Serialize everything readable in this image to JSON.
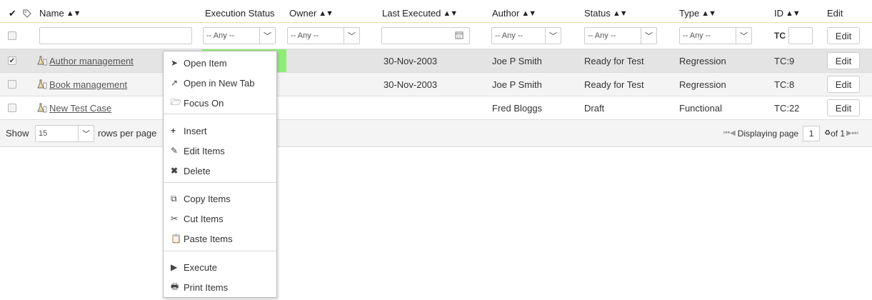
{
  "header": {
    "check_icon": "✔",
    "tag_icon": "🏷",
    "name": "Name",
    "execution_status": "Execution Status",
    "owner": "Owner",
    "last_executed": "Last Executed",
    "author": "Author",
    "status": "Status",
    "type": "Type",
    "id": "ID",
    "edit": "Edit",
    "sort_glyph": "▲▼"
  },
  "filters": {
    "any": "-- Any --",
    "id_prefix": "TC",
    "edit_label": "Edit"
  },
  "rows": [
    {
      "name": "Author management",
      "last_executed": "30-Nov-2003",
      "author": "Joe P Smith",
      "status": "Ready for Test",
      "type": "Regression",
      "id": "TC:9",
      "edit": "Edit",
      "checked": true
    },
    {
      "name": "Book management",
      "last_executed": "30-Nov-2003",
      "author": "Joe P Smith",
      "status": "Ready for Test",
      "type": "Regression",
      "id": "TC:8",
      "edit": "Edit",
      "checked": false
    },
    {
      "name": "New Test Case",
      "last_executed": "",
      "author": "Fred Bloggs",
      "status": "Draft",
      "type": "Functional",
      "id": "TC:22",
      "edit": "Edit",
      "checked": false
    }
  ],
  "pager": {
    "show": "Show",
    "page_size": "15",
    "rows_per_page": "rows per page",
    "displaying_page": "Displaying page",
    "current_page": "1",
    "of_total": "of 1"
  },
  "context_menu": {
    "open_item": "Open Item",
    "open_new_tab": "Open in New Tab",
    "focus_on": "Focus On",
    "insert": "Insert",
    "edit_items": "Edit Items",
    "delete": "Delete",
    "copy_items": "Copy Items",
    "cut_items": "Cut Items",
    "paste_items": "Paste Items",
    "execute": "Execute",
    "print_items": "Print Items"
  },
  "colors": {
    "execution_passed": "#90ee78",
    "header_border": "#f3d9a8"
  }
}
